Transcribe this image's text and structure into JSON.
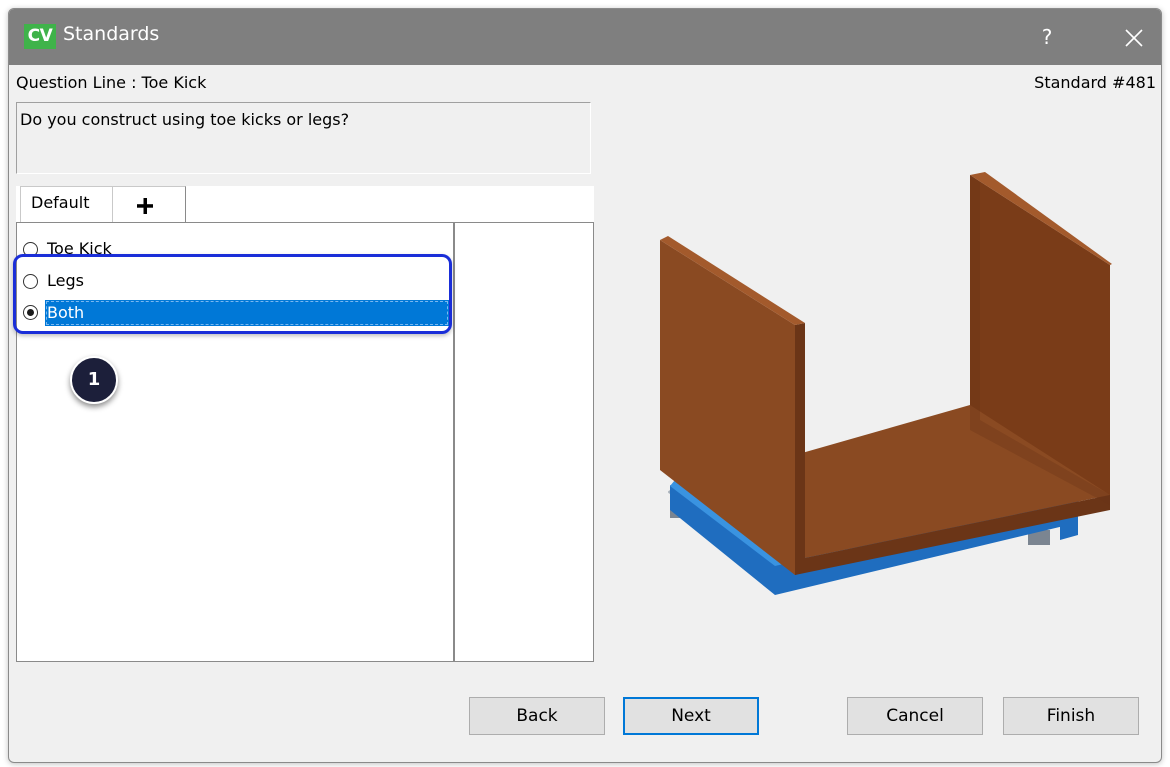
{
  "window": {
    "app_logo": "CV",
    "title": "Standards",
    "help_label": "?"
  },
  "header": {
    "question_line": "Question Line : Toe Kick",
    "standard_number": "Standard #481"
  },
  "question": {
    "text": "Do you construct using toe kicks or legs?"
  },
  "tabs": [
    {
      "label": "Default",
      "selected": true
    },
    {
      "label": "+",
      "icon": "plus-icon"
    }
  ],
  "options": [
    {
      "label": "Toe Kick",
      "selected": false
    },
    {
      "label": "Legs",
      "selected": false
    },
    {
      "label": "Both",
      "selected": true
    }
  ],
  "annotation": {
    "step_number": "1",
    "highlight_color": "#1a2ed8"
  },
  "buttons": {
    "back": "Back",
    "next": "Next",
    "cancel": "Cancel",
    "finish": "Finish"
  },
  "colors": {
    "titlebar": "#7f7f7f",
    "logo_bg": "#3fb34a",
    "selection": "#0078d7",
    "cabinet_wood": "#8a4a22",
    "base_blue": "#2a7fd0"
  }
}
